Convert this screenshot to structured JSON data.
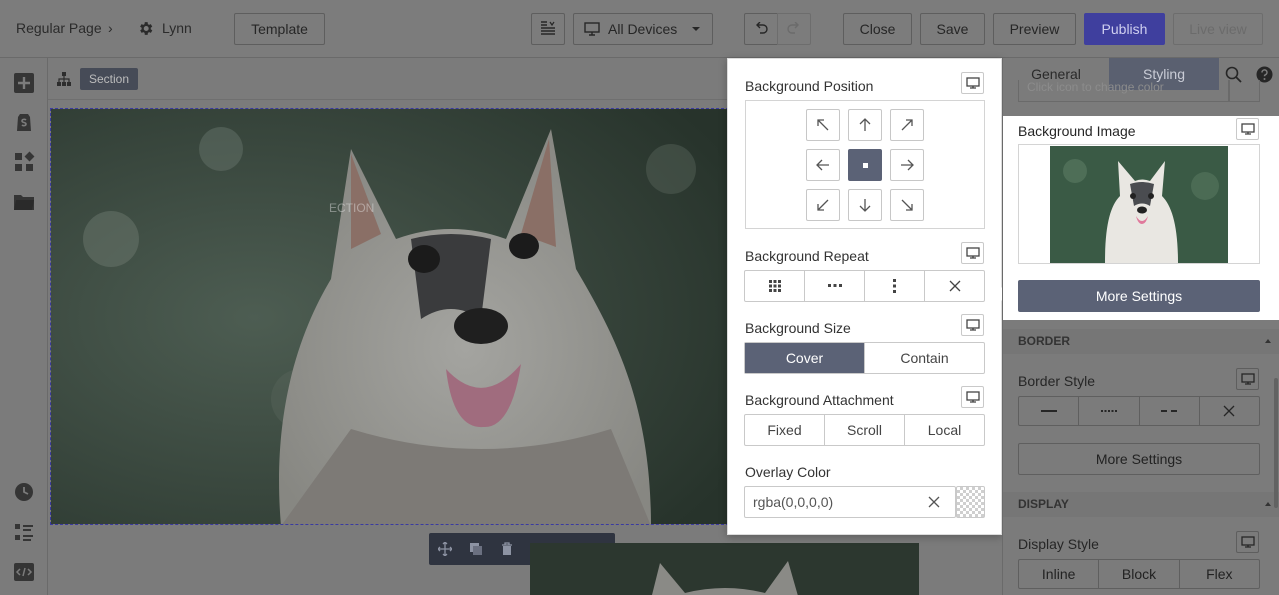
{
  "topbar": {
    "breadcrumb_page": "Regular Page",
    "breadcrumb_sep": "›",
    "breadcrumb_name": "Lynn",
    "template_label": "Template",
    "devices_label": "All Devices",
    "close_label": "Close",
    "save_label": "Save",
    "preview_label": "Preview",
    "publish_label": "Publish",
    "liveview_label": "Live view"
  },
  "canvas": {
    "section_tag": "Section",
    "ghost_text": "ECTION"
  },
  "popover": {
    "position_label": "Background Position",
    "repeat_label": "Background Repeat",
    "size_label": "Background Size",
    "size_options": [
      "Cover",
      "Contain"
    ],
    "size_selected": "Cover",
    "attachment_label": "Background Attachment",
    "attachment_options": [
      "Fixed",
      "Scroll",
      "Local"
    ],
    "overlay_label": "Overlay Color",
    "overlay_value": "rgba(0,0,0,0)"
  },
  "rightpanel": {
    "tabs": [
      "General",
      "Styling"
    ],
    "active_tab": "Styling",
    "faded_hint": "Click icon to change color",
    "bg_image_label": "Background Image",
    "more_settings_label": "More Settings",
    "border_head": "BORDER",
    "border_style_label": "Border Style",
    "border_more_label": "More Settings",
    "display_head": "DISPLAY",
    "display_style_label": "Display Style",
    "display_options": [
      "Inline",
      "Block",
      "Flex"
    ]
  },
  "colors": {
    "accent": "#5b6276",
    "publish": "#3f3f9e",
    "overlay_dim": "#7b7b7b"
  }
}
